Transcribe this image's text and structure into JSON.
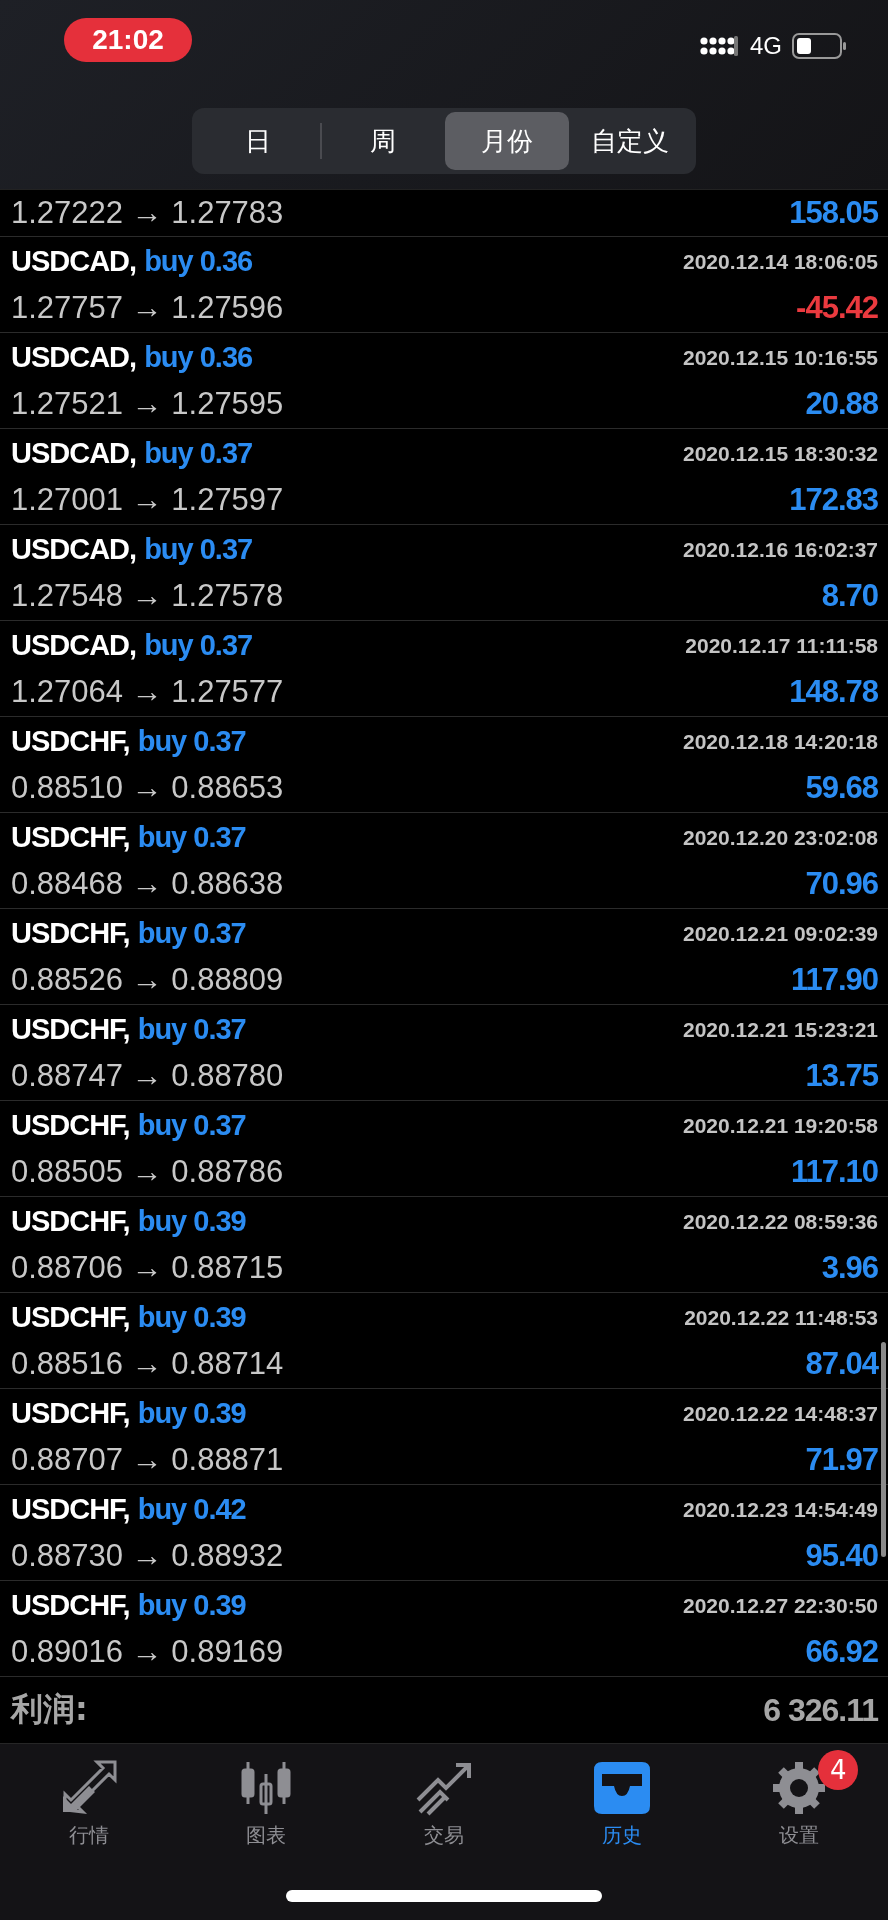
{
  "status_bar": {
    "time": "21:02",
    "network": "4G"
  },
  "period_tabs": [
    {
      "label": "日",
      "selected": false
    },
    {
      "label": "周",
      "selected": false
    },
    {
      "label": "月份",
      "selected": true
    },
    {
      "label": "自定义",
      "selected": false
    }
  ],
  "partial_deal": {
    "prices": "1.27222 → 1.27783",
    "profit": "158.05",
    "loss": false
  },
  "deals": [
    {
      "symbol": "USDCAD,",
      "side": "buy 0.36",
      "time": "2020.12.14 18:06:05",
      "prices": "1.27757 → 1.27596",
      "profit": "-45.42",
      "loss": true
    },
    {
      "symbol": "USDCAD,",
      "side": "buy 0.36",
      "time": "2020.12.15 10:16:55",
      "prices": "1.27521 → 1.27595",
      "profit": "20.88",
      "loss": false
    },
    {
      "symbol": "USDCAD,",
      "side": "buy 0.37",
      "time": "2020.12.15 18:30:32",
      "prices": "1.27001 → 1.27597",
      "profit": "172.83",
      "loss": false
    },
    {
      "symbol": "USDCAD,",
      "side": "buy 0.37",
      "time": "2020.12.16 16:02:37",
      "prices": "1.27548 → 1.27578",
      "profit": "8.70",
      "loss": false
    },
    {
      "symbol": "USDCAD,",
      "side": "buy 0.37",
      "time": "2020.12.17 11:11:58",
      "prices": "1.27064 → 1.27577",
      "profit": "148.78",
      "loss": false
    },
    {
      "symbol": "USDCHF,",
      "side": "buy 0.37",
      "time": "2020.12.18 14:20:18",
      "prices": "0.88510 → 0.88653",
      "profit": "59.68",
      "loss": false
    },
    {
      "symbol": "USDCHF,",
      "side": "buy 0.37",
      "time": "2020.12.20 23:02:08",
      "prices": "0.88468 → 0.88638",
      "profit": "70.96",
      "loss": false
    },
    {
      "symbol": "USDCHF,",
      "side": "buy 0.37",
      "time": "2020.12.21 09:02:39",
      "prices": "0.88526 → 0.88809",
      "profit": "117.90",
      "loss": false
    },
    {
      "symbol": "USDCHF,",
      "side": "buy 0.37",
      "time": "2020.12.21 15:23:21",
      "prices": "0.88747 → 0.88780",
      "profit": "13.75",
      "loss": false
    },
    {
      "symbol": "USDCHF,",
      "side": "buy 0.37",
      "time": "2020.12.21 19:20:58",
      "prices": "0.88505 → 0.88786",
      "profit": "117.10",
      "loss": false
    },
    {
      "symbol": "USDCHF,",
      "side": "buy 0.39",
      "time": "2020.12.22 08:59:36",
      "prices": "0.88706 → 0.88715",
      "profit": "3.96",
      "loss": false
    },
    {
      "symbol": "USDCHF,",
      "side": "buy 0.39",
      "time": "2020.12.22 11:48:53",
      "prices": "0.88516 → 0.88714",
      "profit": "87.04",
      "loss": false
    },
    {
      "symbol": "USDCHF,",
      "side": "buy 0.39",
      "time": "2020.12.22 14:48:37",
      "prices": "0.88707 → 0.88871",
      "profit": "71.97",
      "loss": false
    },
    {
      "symbol": "USDCHF,",
      "side": "buy 0.42",
      "time": "2020.12.23 14:54:49",
      "prices": "0.88730 → 0.88932",
      "profit": "95.40",
      "loss": false
    },
    {
      "symbol": "USDCHF,",
      "side": "buy 0.39",
      "time": "2020.12.27 22:30:50",
      "prices": "0.89016 → 0.89169",
      "profit": "66.92",
      "loss": false
    }
  ],
  "summary": {
    "label": "利润:",
    "value": "6 326.11"
  },
  "tab_bar": [
    {
      "kind": "quotes",
      "label": "行情",
      "selected": false
    },
    {
      "kind": "chart",
      "label": "图表",
      "selected": false
    },
    {
      "kind": "trade",
      "label": "交易",
      "selected": false
    },
    {
      "kind": "history",
      "label": "历史",
      "selected": true
    },
    {
      "kind": "settings",
      "label": "设置",
      "selected": false,
      "badge": "4"
    }
  ]
}
